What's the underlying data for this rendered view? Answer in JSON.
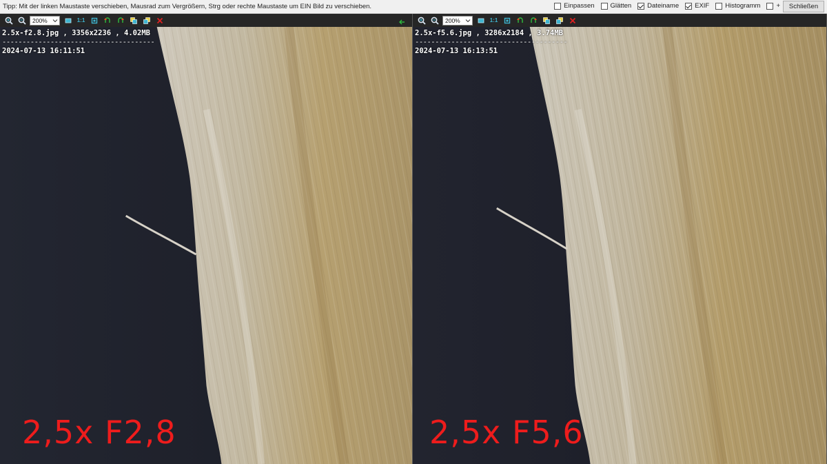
{
  "topbar": {
    "tip": "Tipp: Mit der linken Maustaste verschieben, Mausrad zum Vergrößern, Strg oder rechte Maustaste um EIN Bild zu verschieben.",
    "options": [
      {
        "label": "Einpassen",
        "checked": false
      },
      {
        "label": "Glätten",
        "checked": false
      },
      {
        "label": "Dateiname",
        "checked": true
      },
      {
        "label": "EXIF",
        "checked": true
      },
      {
        "label": "Histogramm",
        "checked": false
      },
      {
        "label": "+",
        "checked": false
      }
    ],
    "close_label": "Schließen"
  },
  "panes": [
    {
      "zoom": "200%",
      "one_to_one": "1:1",
      "filename": "2.5x-f2.8.jpg",
      "dimensions": "3356x2236",
      "filesize": "4.02MB",
      "separator": "--------------------------------------",
      "datetime": "2024-07-13 16:11:51",
      "overlay": "2,5x F2,8"
    },
    {
      "zoom": "200%",
      "one_to_one": "1:1",
      "filename": "2.5x-f5.6.jpg",
      "dimensions": "3286x2184",
      "filesize": "3.74MB",
      "separator": "--------------------------------------",
      "datetime": "2024-07-13 16:13:51",
      "overlay": "2,5x F5,6"
    }
  ],
  "colors": {
    "overlay_text": "#ee1c1c",
    "icon_accent": "#3fb5d0",
    "delete_icon": "#e02020",
    "back_arrow": "#2fbf3f"
  }
}
